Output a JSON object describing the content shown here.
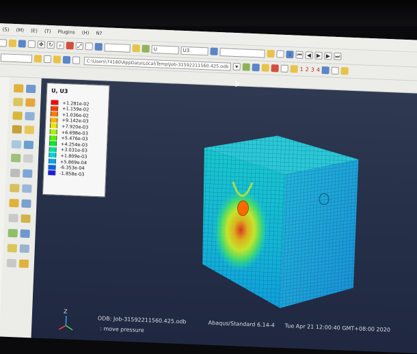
{
  "menu": {
    "items": [
      "(S)",
      "(M)",
      "(E)",
      "(T)",
      "Plugins",
      "(H)",
      "N?"
    ]
  },
  "toolbar": {
    "model_label": "",
    "module_combo": "",
    "step_combo": "U",
    "var_combo": "U3",
    "module_label": "",
    "module_value": "",
    "model_label2": "",
    "path": "C:\\Users\\74180\\AppData\\Local\\Temp\\Job-31592211560.425.odb",
    "numbers": [
      "1",
      "2",
      "3",
      "4"
    ]
  },
  "legend": {
    "title": "U, U3",
    "entries": [
      {
        "label": "+1.281e-02",
        "color": "#ff0000"
      },
      {
        "label": "+1.159e-02",
        "color": "#ff3a00"
      },
      {
        "label": "+1.036e-02",
        "color": "#ff7a00"
      },
      {
        "label": "+9.142e-03",
        "color": "#ffb400"
      },
      {
        "label": "+7.920e-03",
        "color": "#e8e400"
      },
      {
        "label": "+6.698e-03",
        "color": "#a8f000"
      },
      {
        "label": "+5.476e-03",
        "color": "#5cee00"
      },
      {
        "label": "+4.254e-03",
        "color": "#00e82a"
      },
      {
        "label": "+3.031e-03",
        "color": "#00e09a"
      },
      {
        "label": "+1.809e-03",
        "color": "#00d2d8"
      },
      {
        "label": "+5.869e-04",
        "color": "#00a4f0"
      },
      {
        "label": "-6.353e-04",
        "color": "#0062ee"
      },
      {
        "label": "-1.858e-03",
        "color": "#1a1ae0"
      }
    ]
  },
  "status": {
    "odb": "ODB: Job-31592211560.425.odb",
    "solver": "Abaqus/Standard 6.14-4",
    "datetime": "Tue Apr 21 12:00:40 GMT+08:00 2020",
    "step": ": move pressure",
    "axis_z": "Z"
  }
}
